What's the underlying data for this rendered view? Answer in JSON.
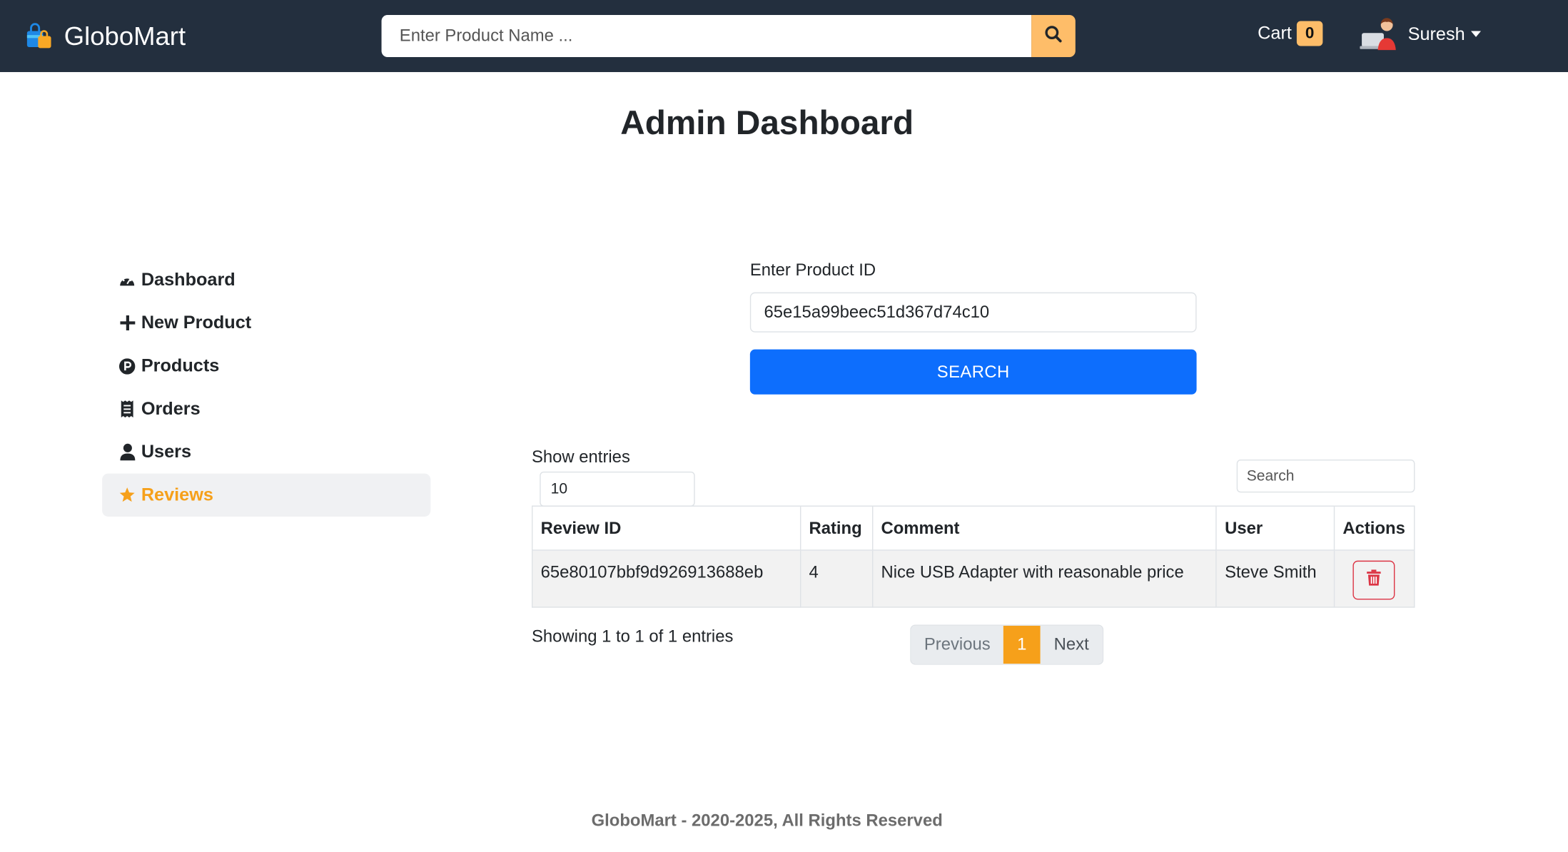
{
  "navbar": {
    "brand": "GloboMart",
    "search_placeholder": "Enter Product Name ...",
    "cart_label": "Cart",
    "cart_count": "0",
    "user_name": "Suresh"
  },
  "page_title": "Admin Dashboard",
  "sidebar": {
    "items": [
      {
        "label": "Dashboard",
        "icon": "tachometer-icon"
      },
      {
        "label": "New Product",
        "icon": "plus-icon"
      },
      {
        "label": "Products",
        "icon": "product-p-icon"
      },
      {
        "label": "Orders",
        "icon": "receipt-icon"
      },
      {
        "label": "Users",
        "icon": "user-icon"
      },
      {
        "label": "Reviews",
        "icon": "star-icon"
      }
    ],
    "active_item": "Reviews"
  },
  "product_form": {
    "label": "Enter Product ID",
    "value": "65e15a99beec51d367d74c10",
    "button": "SEARCH"
  },
  "table": {
    "entries_label": "Show entries",
    "entries_value": "10",
    "search_placeholder": "Search",
    "columns": [
      "Review ID",
      "Rating",
      "Comment",
      "User",
      "Actions"
    ],
    "rows": [
      {
        "id": "65e80107bbf9d926913688eb",
        "rating": "4",
        "comment": "Nice USB Adapter with reasonable price",
        "user": "Steve Smith"
      }
    ],
    "info": "Showing 1 to 1 of 1 entries",
    "pagination": {
      "previous": "Previous",
      "current": "1",
      "next": "Next"
    }
  },
  "footer": "GloboMart - 2020-2025, All Rights Reserved",
  "colors": {
    "navbar_bg": "#232f3e",
    "accent_orange": "#febd69",
    "active_orange": "#f6a01a",
    "primary_blue": "#0d6efd",
    "danger_red": "#dc3545"
  }
}
